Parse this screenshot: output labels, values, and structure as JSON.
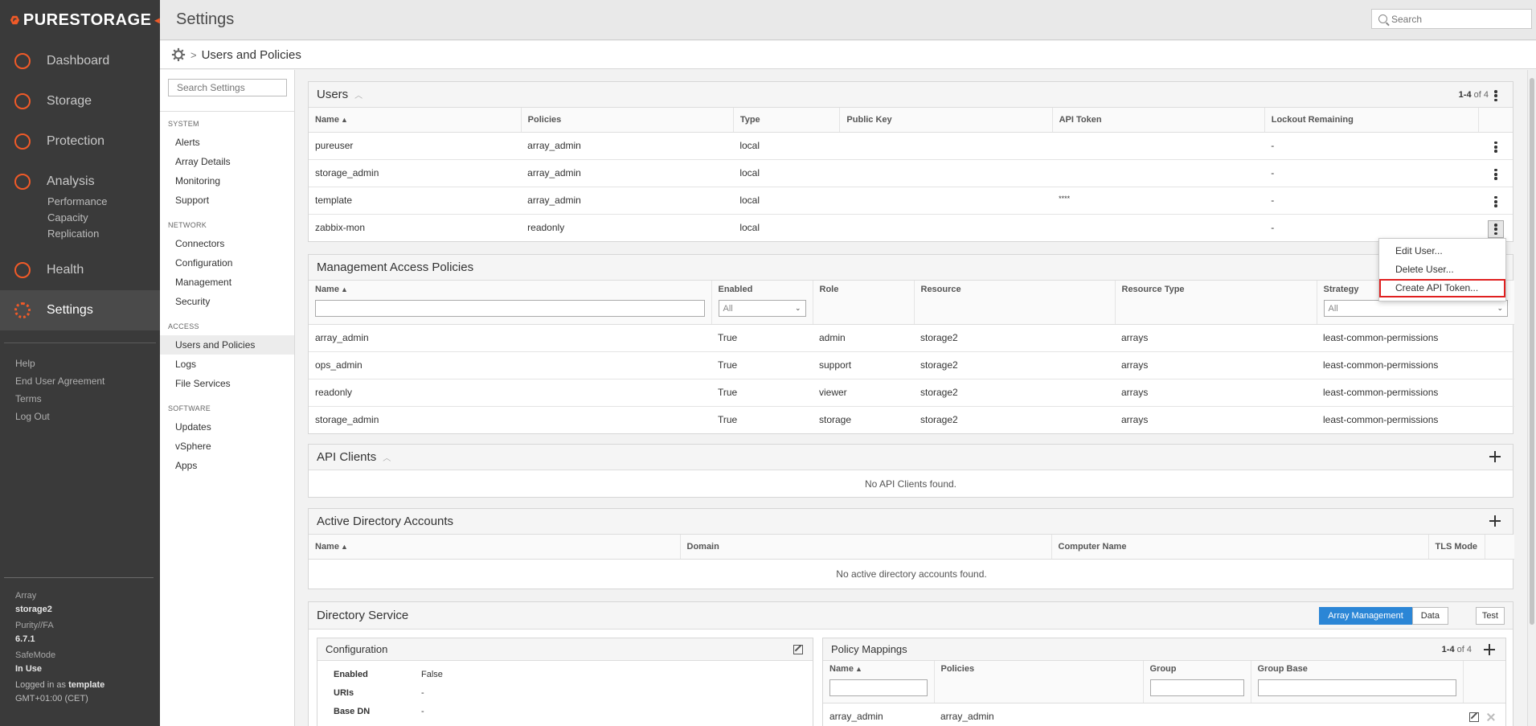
{
  "app": {
    "brand": "PURESTORAGE",
    "page_title": "Settings",
    "search_placeholder": "Search"
  },
  "nav": {
    "items": [
      {
        "label": "Dashboard",
        "icon": "dashboard-icon"
      },
      {
        "label": "Storage",
        "icon": "storage-icon"
      },
      {
        "label": "Protection",
        "icon": "protection-icon"
      },
      {
        "label": "Analysis",
        "icon": "analysis-icon"
      },
      {
        "label": "Health",
        "icon": "health-icon"
      },
      {
        "label": "Settings",
        "icon": "settings-icon"
      }
    ],
    "analysis_sub": [
      "Performance",
      "Capacity",
      "Replication"
    ],
    "links": [
      "Help",
      "End User Agreement",
      "Terms",
      "Log Out"
    ],
    "array_label": "Array",
    "array_name": "storage2",
    "purity_label": "Purity//FA",
    "purity_version": "6.7.1",
    "safemode_label": "SafeMode",
    "safemode_value": "In Use",
    "logged_in_prefix": "Logged in as",
    "logged_in_user": "template",
    "timezone": "GMT+01:00 (CET)"
  },
  "breadcrumb": {
    "current": "Users and Policies"
  },
  "settings_sidebar": {
    "search_placeholder": "Search Settings",
    "sections": [
      {
        "title": "SYSTEM",
        "items": [
          "Alerts",
          "Array Details",
          "Monitoring",
          "Support"
        ]
      },
      {
        "title": "NETWORK",
        "items": [
          "Connectors",
          "Configuration",
          "Management",
          "Security"
        ]
      },
      {
        "title": "ACCESS",
        "items": [
          "Users and Policies",
          "Logs",
          "File Services"
        ]
      },
      {
        "title": "SOFTWARE",
        "items": [
          "Updates",
          "vSphere",
          "Apps"
        ]
      }
    ]
  },
  "users": {
    "title": "Users",
    "count_range": "1-4",
    "count_total": "of 4",
    "columns": [
      "Name",
      "Policies",
      "Type",
      "Public Key",
      "API Token",
      "Lockout Remaining"
    ],
    "rows": [
      [
        "pureuser",
        "array_admin",
        "local",
        "",
        "",
        "-"
      ],
      [
        "storage_admin",
        "array_admin",
        "local",
        "",
        "",
        "-"
      ],
      [
        "template",
        "array_admin",
        "local",
        "",
        "****",
        "-"
      ],
      [
        "zabbix-mon",
        "readonly",
        "local",
        "",
        "",
        "-"
      ]
    ]
  },
  "context_menu": {
    "items": [
      "Edit User...",
      "Delete User...",
      "Create API Token..."
    ]
  },
  "policies": {
    "title": "Management Access Policies",
    "columns": [
      "Name",
      "Enabled",
      "Role",
      "Resource",
      "Resource Type",
      "Strategy"
    ],
    "filter_all": "All",
    "rows": [
      [
        "array_admin",
        "True",
        "admin",
        "storage2",
        "arrays",
        "least-common-permissions"
      ],
      [
        "ops_admin",
        "True",
        "support",
        "storage2",
        "arrays",
        "least-common-permissions"
      ],
      [
        "readonly",
        "True",
        "viewer",
        "storage2",
        "arrays",
        "least-common-permissions"
      ],
      [
        "storage_admin",
        "True",
        "storage",
        "storage2",
        "arrays",
        "least-common-permissions"
      ]
    ]
  },
  "api_clients": {
    "title": "API Clients",
    "empty": "No API Clients found."
  },
  "ad_accounts": {
    "title": "Active Directory Accounts",
    "columns": [
      "Name",
      "Domain",
      "Computer Name",
      "TLS Mode"
    ],
    "empty": "No active directory accounts found."
  },
  "directory_service": {
    "title": "Directory Service",
    "tabs": [
      "Array Management",
      "Data"
    ],
    "test_label": "Test",
    "config": {
      "title": "Configuration",
      "fields": [
        {
          "key": "Enabled",
          "value": "False"
        },
        {
          "key": "URIs",
          "value": "-"
        },
        {
          "key": "Base DN",
          "value": "-"
        }
      ]
    },
    "mappings": {
      "title": "Policy Mappings",
      "count_range": "1-4",
      "count_total": "of 4",
      "columns": [
        "Name",
        "Policies",
        "Group",
        "Group Base"
      ],
      "rows": [
        [
          "array_admin",
          "array_admin",
          "",
          ""
        ]
      ]
    }
  },
  "colors": {
    "accent": "#f05a28",
    "primary": "#2b86d6",
    "highlight": "#e02020",
    "nav_bg": "#3a3a3a"
  }
}
